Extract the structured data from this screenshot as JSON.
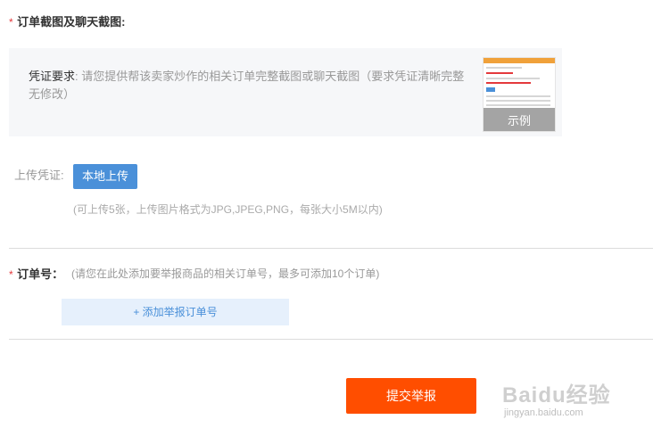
{
  "evidence_section": {
    "required_mark": "*",
    "title": "订单截图及聊天截图:"
  },
  "requirement": {
    "label": "凭证要求",
    "text": ": 请您提供帮该卖家炒作的相关订单完整截图或聊天截图（要求凭证清晰完整无修改）",
    "example_caption": "示例"
  },
  "upload": {
    "label": "上传凭证:",
    "button_label": "本地上传",
    "hint": "(可上传5张，上传图片格式为JPG,JPEG,PNG，每张大小5M以内)"
  },
  "order_section": {
    "required_mark": "*",
    "title": "订单号：",
    "hint": "(请您在此处添加要举报商品的相关订单号，最多可添加10个订单)",
    "add_button_label": "+ 添加举报订单号"
  },
  "submit": {
    "label": "提交举报"
  },
  "watermark": {
    "main": "Baidu经验",
    "sub": "jingyan.baidu.com"
  },
  "colors": {
    "required": "#e4393c",
    "primary_blue": "#4a90d9",
    "submit_orange": "#ff4e00",
    "panel_bg": "#f6f7f9"
  }
}
